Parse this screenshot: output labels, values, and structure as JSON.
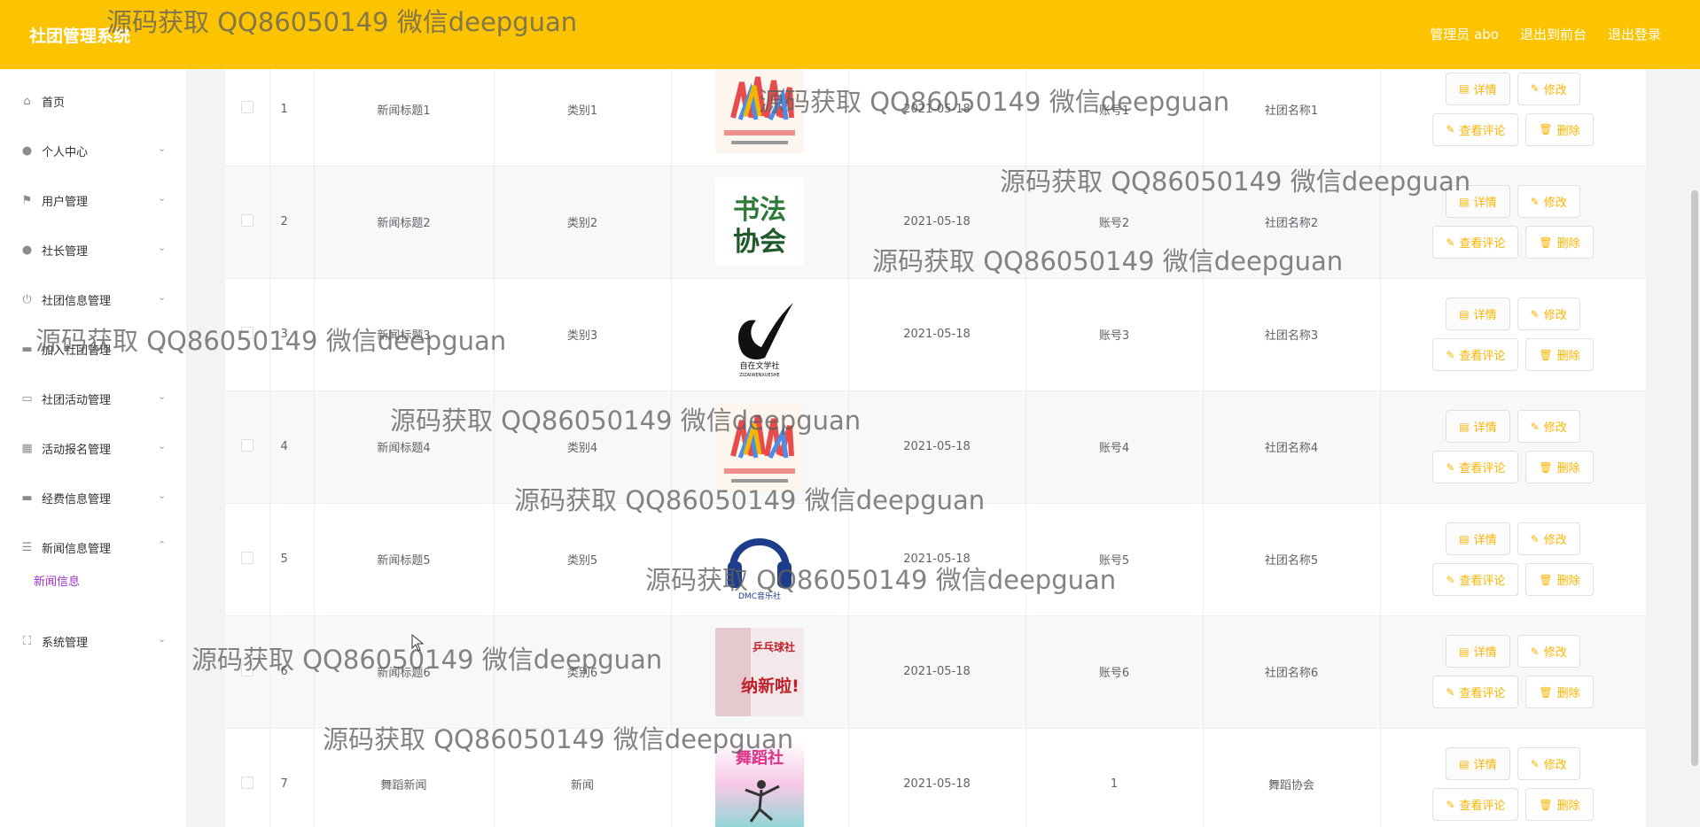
{
  "app": {
    "title": "社团管理系统"
  },
  "header": {
    "user": "管理员 abo",
    "to_front": "退出到前台",
    "logout": "退出登录"
  },
  "sidebar": {
    "items": [
      {
        "label": "首页",
        "icon": "home-icon",
        "expanded": null
      },
      {
        "label": "个人中心",
        "icon": "user-icon",
        "expanded": false
      },
      {
        "label": "用户管理",
        "icon": "flag-icon",
        "expanded": false
      },
      {
        "label": "社长管理",
        "icon": "location-icon",
        "expanded": false
      },
      {
        "label": "社团信息管理",
        "icon": "power-icon",
        "expanded": false
      },
      {
        "label": "加入社团管理",
        "icon": "card-icon",
        "expanded": false
      },
      {
        "label": "社团活动管理",
        "icon": "chat-icon",
        "expanded": false
      },
      {
        "label": "活动报名管理",
        "icon": "grid-icon",
        "expanded": false
      },
      {
        "label": "经费信息管理",
        "icon": "wallet-icon",
        "expanded": false
      },
      {
        "label": "新闻信息管理",
        "icon": "list-icon",
        "expanded": true
      },
      {
        "label": "系统管理",
        "icon": "fullscreen-icon",
        "expanded": false
      }
    ],
    "active_sub": "新闻信息"
  },
  "table": {
    "rows": [
      {
        "index": "1",
        "title": "新闻标题1",
        "category": "类别1",
        "image": "hands-poster",
        "date": "2021-05-18",
        "account": "账号1",
        "club": "社团名称1"
      },
      {
        "index": "2",
        "title": "新闻标题2",
        "category": "类别2",
        "image": "calligraphy-logo",
        "date": "2021-05-18",
        "account": "账号2",
        "club": "社团名称2"
      },
      {
        "index": "3",
        "title": "新闻标题3",
        "category": "类别3",
        "image": "literature-logo",
        "date": "2021-05-18",
        "account": "账号3",
        "club": "社团名称3"
      },
      {
        "index": "4",
        "title": "新闻标题4",
        "category": "类别4",
        "image": "hands-poster",
        "date": "2021-05-18",
        "account": "账号4",
        "club": "社团名称4"
      },
      {
        "index": "5",
        "title": "新闻标题5",
        "category": "类别5",
        "image": "music-logo",
        "date": "2021-05-18",
        "account": "账号5",
        "club": "社团名称5"
      },
      {
        "index": "6",
        "title": "新闻标题6",
        "category": "类别6",
        "image": "pingpong-poster",
        "date": "2021-05-18",
        "account": "账号6",
        "club": "社团名称6"
      },
      {
        "index": "7",
        "title": "舞蹈新闻",
        "category": "新闻",
        "image": "dance-poster",
        "date": "2021-05-18",
        "account": "1",
        "club": "舞蹈协会"
      }
    ],
    "buttons": {
      "detail": "详情",
      "edit": "修改",
      "comments": "查看评论",
      "delete": "删除"
    }
  },
  "images": {
    "literature_caption": "自在文学社",
    "literature_pinyin": "ZIZAIWENXUESHE",
    "calligraphy_text": "书法 协会",
    "pingpong_text": "乒乓球社",
    "recruit_text": "纳新啦!",
    "dance_text": "舞蹈社",
    "music_text": "DMC音乐社"
  },
  "watermark": "源码获取 QQ86050149 微信deepguan",
  "colors": {
    "header": "#fcc400",
    "accent_button_text": "#fcb400",
    "active_sub": "#a032c8"
  }
}
